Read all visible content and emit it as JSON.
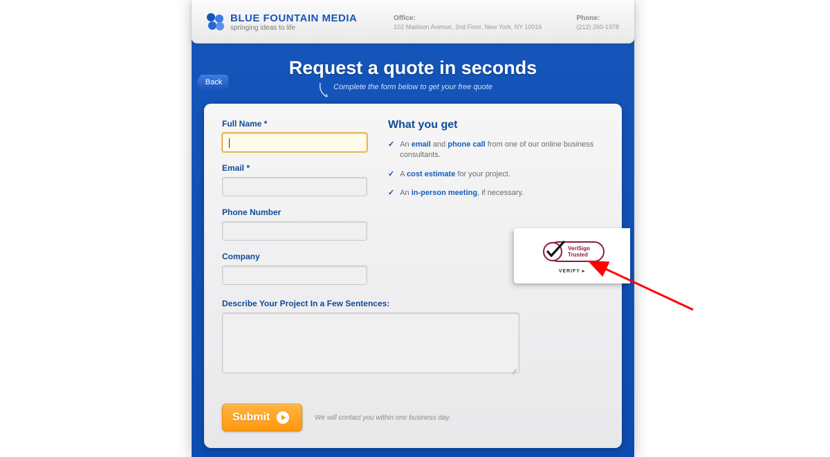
{
  "header": {
    "brand": "BLUE FOUNTAIN MEDIA",
    "tagline": "springing ideas to life",
    "office_label": "Office:",
    "office_value": "102 Madison Avenue, 2nd Floor, New York, NY 10016",
    "phone_label": "Phone:",
    "phone_value": "(212) 260-1978"
  },
  "nav": {
    "back_label": "Back"
  },
  "hero": {
    "title": "Request a quote in seconds",
    "subtitle": "Complete the form below to get your free quote"
  },
  "form": {
    "full_name_label": "Full Name *",
    "full_name_value": "",
    "email_label": "Email *",
    "email_value": "",
    "phone_label": "Phone Number",
    "phone_value": "",
    "company_label": "Company",
    "company_value": "",
    "project_label": "Describe Your Project In a Few Sentences:",
    "project_value": "",
    "submit_label": "Submit",
    "submit_note": "We will contact you within one business day."
  },
  "sidebar": {
    "title": "What you get",
    "items": [
      {
        "pre": "An ",
        "bold1": "email",
        "mid": " and ",
        "bold2": "phone call",
        "post": " from one of our online business consultants."
      },
      {
        "pre": "A ",
        "bold1": "cost estimate",
        "mid": "",
        "bold2": "",
        "post": " for your project."
      },
      {
        "pre": "An ",
        "bold1": "in-person meeting",
        "mid": "",
        "bold2": "",
        "post": ", if necessary."
      }
    ]
  },
  "trust": {
    "brand1": "VeriSign",
    "brand2": "Trusted",
    "verify": "VERIFY ▸"
  }
}
